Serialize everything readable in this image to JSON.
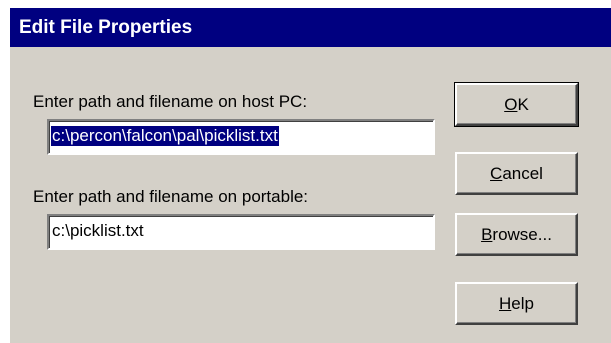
{
  "window": {
    "title": "Edit File Properties"
  },
  "host": {
    "label": "Enter path and filename on host PC:",
    "value": "c:\\percon\\falcon\\pal\\picklist.txt"
  },
  "portable": {
    "label": "Enter path and filename on portable:",
    "value": "c:\\picklist.txt"
  },
  "buttons": {
    "ok": {
      "mnemonic": "O",
      "rest": "K"
    },
    "cancel": {
      "mnemonic": "C",
      "rest": "ancel"
    },
    "browse": {
      "mnemonic": "B",
      "rest": "rowse..."
    },
    "help": {
      "mnemonic": "H",
      "rest": "elp"
    }
  },
  "colors": {
    "titlebar": "#000080",
    "face": "#d4d0c8",
    "selection": "#000080"
  }
}
